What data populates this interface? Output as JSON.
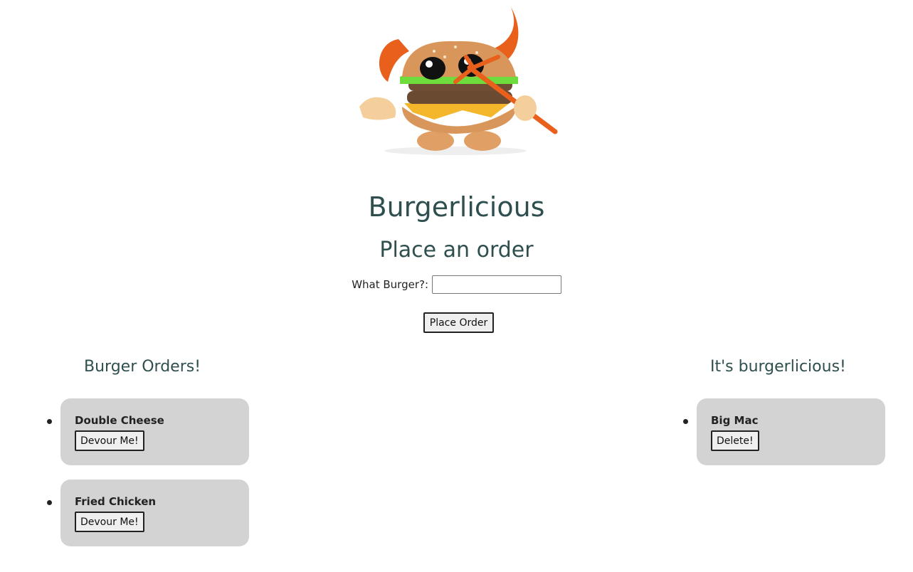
{
  "header": {
    "title": "Burgerlicious",
    "subtitle": "Place an order"
  },
  "order_form": {
    "label": "What Burger?:",
    "input_value": "",
    "submit_label": "Place Order"
  },
  "orders_column": {
    "heading": "Burger Orders!",
    "items": [
      {
        "name": "Double Cheese",
        "action": "Devour Me!"
      },
      {
        "name": "Fried Chicken",
        "action": "Devour Me!"
      }
    ]
  },
  "devoured_column": {
    "heading": "It's burgerlicious!",
    "items": [
      {
        "name": "Big Mac",
        "action": "Delete!"
      }
    ]
  },
  "colors": {
    "heading": "#2f4f4f",
    "card_background": "#d3d3d3"
  },
  "hero_image": {
    "icon": "devil-burger-mascot"
  }
}
